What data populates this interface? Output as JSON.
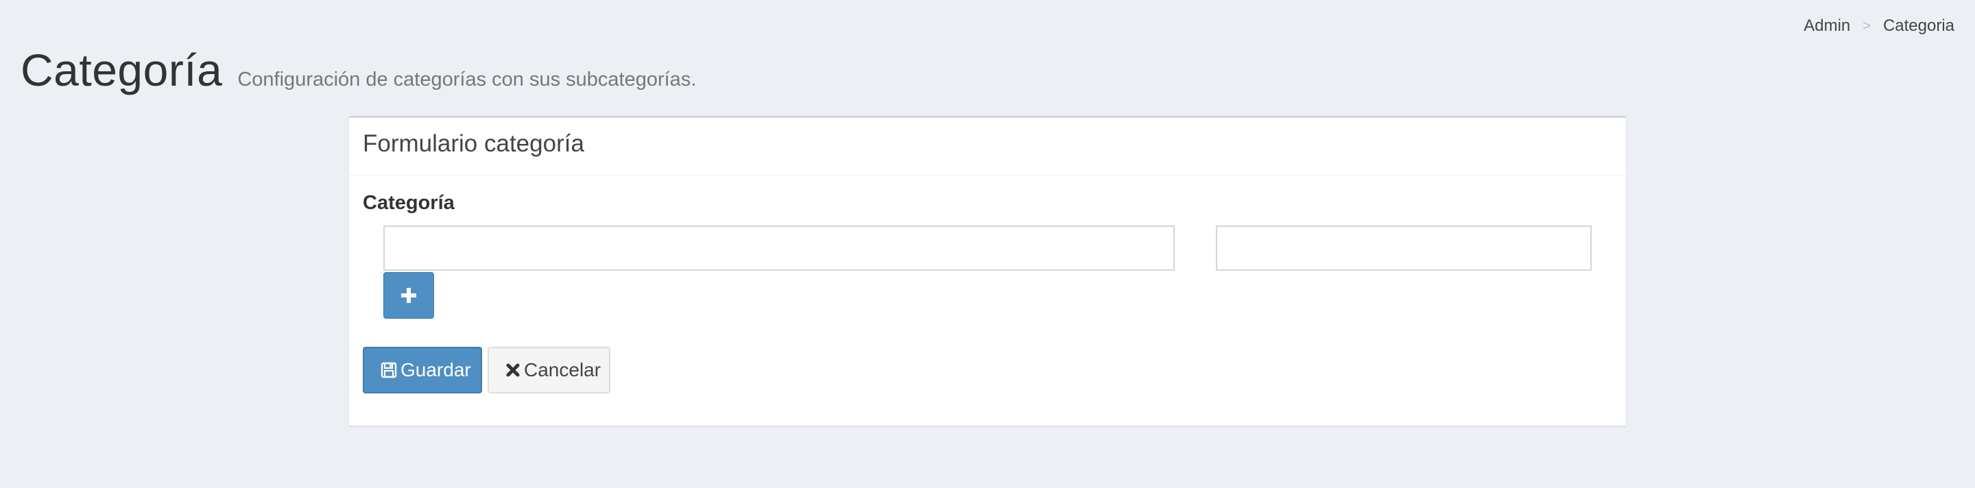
{
  "breadcrumb": {
    "items": [
      "Admin",
      "Categoria"
    ],
    "separator": ">"
  },
  "header": {
    "title": "Categoría",
    "subtitle": "Configuración de categorías con sus subcategorías."
  },
  "form": {
    "box_title": "Formulario categoría",
    "category_label": "Categoría",
    "category_input": {
      "value": "",
      "placeholder": ""
    },
    "subcategory_input": {
      "value": "",
      "placeholder": ""
    },
    "add_icon": "plus-icon",
    "save_button": {
      "label": "Guardar",
      "icon": "save-icon"
    },
    "cancel_button": {
      "label": "Cancelar",
      "icon": "close-icon"
    }
  },
  "colors": {
    "background": "#ecf0f5",
    "primary": "#4f8fc3",
    "box_border": "#d2d6de"
  }
}
